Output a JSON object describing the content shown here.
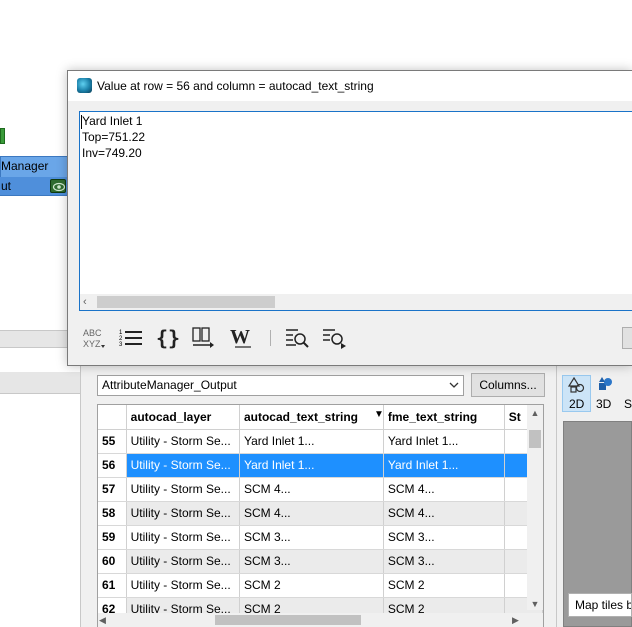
{
  "background": {
    "node_title": "Manager",
    "node_port": "ut"
  },
  "dialog": {
    "title": "Value at row = 56 and column = autocad_text_string",
    "text_lines": [
      "Yard Inlet 1",
      "Top=751.22",
      "Inv=749.20"
    ],
    "toolbar_icons": [
      "abc-xyz-icon",
      "numbered-list-icon",
      "braces-icon",
      "wrap-icon",
      "w-icon",
      "find-icon",
      "find-next-icon"
    ]
  },
  "inspector": {
    "feature_type": "AttributeManager_Output",
    "columns_button": "Columns...",
    "table": {
      "headers": [
        "",
        "autocad_layer",
        "autocad_text_string",
        "fme_text_string",
        "St"
      ],
      "sorted_column": "autocad_text_string",
      "selected_row": 56,
      "rows": [
        [
          "55",
          "Utility - Storm Se...",
          "Yard Inlet 1...",
          "Yard Inlet 1..."
        ],
        [
          "56",
          "Utility - Storm Se...",
          "Yard Inlet 1...",
          "Yard Inlet 1..."
        ],
        [
          "57",
          "Utility - Storm Se...",
          "SCM 4...",
          "SCM 4..."
        ],
        [
          "58",
          "Utility - Storm Se...",
          "SCM 4...",
          "SCM 4..."
        ],
        [
          "59",
          "Utility - Storm Se...",
          "SCM 3...",
          "SCM 3..."
        ],
        [
          "60",
          "Utility - Storm Se...",
          "SCM 3...",
          "SCM 3..."
        ],
        [
          "61",
          "Utility - Storm Se...",
          "SCM 2",
          "SCM 2"
        ],
        [
          "62",
          "Utility - Storm Se...",
          "SCM 2",
          "SCM 2"
        ]
      ]
    }
  },
  "map": {
    "btn_2d": "2D",
    "btn_3d": "3D",
    "btn_s": "S",
    "tiles_label": "Map tiles b"
  },
  "colors": {
    "selection": "#1e90ff",
    "node_blue": "#6aa6e8",
    "text_border": "#1a73c8"
  }
}
